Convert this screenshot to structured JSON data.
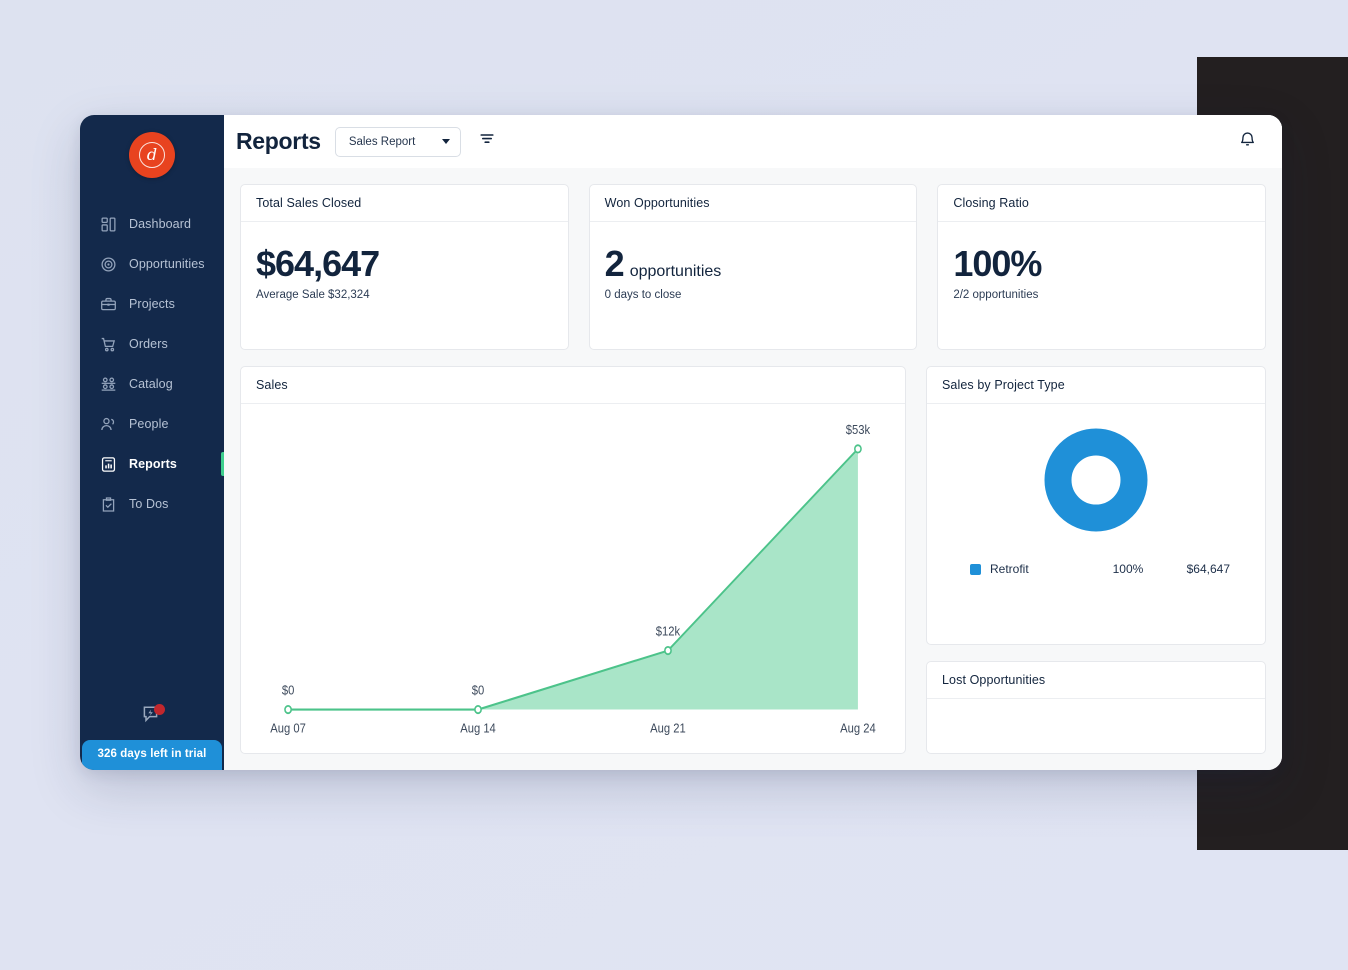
{
  "window": {
    "title": "Reports"
  },
  "brand": {
    "logo_glyph": "d",
    "logo_color": "#e8431f"
  },
  "sidebar": {
    "items": [
      {
        "label": "Dashboard",
        "icon": "dashboard-icon",
        "active": false
      },
      {
        "label": "Opportunities",
        "icon": "target-icon",
        "active": false
      },
      {
        "label": "Projects",
        "icon": "briefcase-icon",
        "active": false
      },
      {
        "label": "Orders",
        "icon": "cart-icon",
        "active": false
      },
      {
        "label": "Catalog",
        "icon": "catalog-icon",
        "active": false
      },
      {
        "label": "People",
        "icon": "people-icon",
        "active": false
      },
      {
        "label": "Reports",
        "icon": "report-icon",
        "active": true
      },
      {
        "label": "To Dos",
        "icon": "clipboard-check-icon",
        "active": false
      }
    ],
    "chat_icon": "chat-bolt-icon",
    "trial_banner": "326 days left in trial",
    "trial_banner_color": "#1f90d8",
    "active_indicator_color": "#3ecf8e",
    "background_color": "#13294b"
  },
  "topbar": {
    "title": "Reports",
    "report_select": {
      "value": "Sales Report",
      "icon": "chevron-down-icon"
    },
    "filter_icon": "filter-icon",
    "bell_icon": "bell-icon"
  },
  "kpis": [
    {
      "title": "Total Sales Closed",
      "value": "$64,647",
      "unit": "",
      "sub": "Average Sale $32,324"
    },
    {
      "title": "Won Opportunities",
      "value": "2",
      "unit": "opportunities",
      "sub": "0 days to close"
    },
    {
      "title": "Closing Ratio",
      "value": "100%",
      "unit": "",
      "sub": "2/2 opportunities"
    }
  ],
  "sales_card": {
    "title": "Sales"
  },
  "donut_card": {
    "title": "Sales by Project Type",
    "legend": [
      {
        "name": "Retrofit",
        "percent": "100%",
        "value": "$64,647",
        "color": "#1f90d8"
      }
    ]
  },
  "lost_card": {
    "title": "Lost Opportunities"
  },
  "chart_data": [
    {
      "type": "area",
      "title": "Sales",
      "x": [
        "Aug 07",
        "Aug 14",
        "Aug 21",
        "Aug 24"
      ],
      "values": [
        0,
        0,
        12000,
        53000
      ],
      "point_labels": [
        "$0",
        "$0",
        "$12k",
        "$53k"
      ],
      "xlabel": "",
      "ylabel": "",
      "ylim": [
        0,
        53000
      ],
      "grid": false,
      "legend": "none",
      "line_color": "#4cc38a",
      "fill_color": "#a9e5c8"
    },
    {
      "type": "pie",
      "title": "Sales by Project Type",
      "categories": [
        "Retrofit"
      ],
      "values": [
        64647
      ],
      "percents": [
        100
      ],
      "labels": [
        "$64,647"
      ],
      "colors": [
        "#1f90d8"
      ],
      "donut": true,
      "legend": "bottom"
    }
  ]
}
